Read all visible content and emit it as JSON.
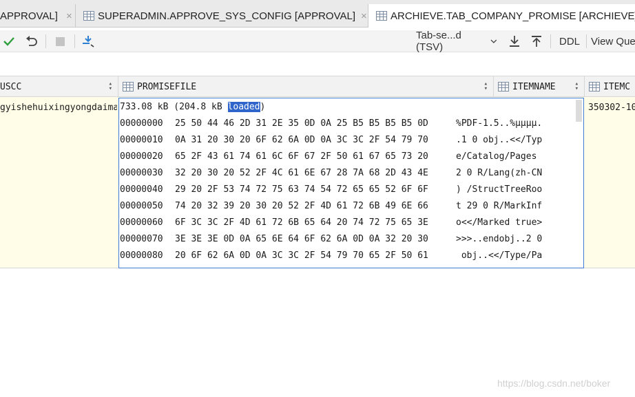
{
  "tabs": [
    {
      "label": "APPROVAL]",
      "close": "×"
    },
    {
      "label": "SUPERADMIN.APPROVE_SYS_CONFIG [APPROVAL]",
      "close": "×"
    },
    {
      "label": "ARCHIEVE.TAB_COMPANY_PROMISE [ARCHIEVE]"
    }
  ],
  "toolbar": {
    "format": "Tab-se...d (TSV)",
    "ddl": "DDL",
    "view_query": "View Que"
  },
  "columns": [
    "USCC",
    "PROMISEFILE",
    "ITEMNAME",
    "ITEMC"
  ],
  "row": {
    "uscc": "gyishehuixingyongdaima",
    "itemcode": "350302-10"
  },
  "binary": {
    "size_prefix": "733.08 kB (204.8 kB ",
    "size_selected": "loaded",
    "size_suffix": ")",
    "rows": [
      {
        "offset": "00000000",
        "hex": "25 50 44 46 2D 31 2E 35 0D 0A 25 B5 B5 B5 B5 0D",
        "text": "%PDF-1.5..%μμμμ."
      },
      {
        "offset": "00000010",
        "hex": "0A 31 20 30 20 6F 62 6A 0D 0A 3C 3C 2F 54 79 70",
        "text": ".1 0 obj..<</Typ"
      },
      {
        "offset": "00000020",
        "hex": "65 2F 43 61 74 61 6C 6F 67 2F 50 61 67 65 73 20",
        "text": "e/Catalog/Pages "
      },
      {
        "offset": "00000030",
        "hex": "32 20 30 20 52 2F 4C 61 6E 67 28 7A 68 2D 43 4E",
        "text": "2 0 R/Lang(zh-CN"
      },
      {
        "offset": "00000040",
        "hex": "29 20 2F 53 74 72 75 63 74 54 72 65 65 52 6F 6F",
        "text": ") /StructTreeRoo"
      },
      {
        "offset": "00000050",
        "hex": "74 20 32 39 20 30 20 52 2F 4D 61 72 6B 49 6E 66",
        "text": "t 29 0 R/MarkInf"
      },
      {
        "offset": "00000060",
        "hex": "6F 3C 3C 2F 4D 61 72 6B 65 64 20 74 72 75 65 3E",
        "text": "o<</Marked true>"
      },
      {
        "offset": "00000070",
        "hex": "3E 3E 3E 0D 0A 65 6E 64 6F 62 6A 0D 0A 32 20 30",
        "text": ">>>..endobj..2 0"
      },
      {
        "offset": "00000080",
        "hex": "20 6F 62 6A 0D 0A 3C 3C 2F 54 79 70 65 2F 50 61",
        "text": " obj..<</Type/Pa"
      }
    ]
  },
  "watermark": "https://blog.csdn.net/boker",
  "colors": {
    "accent": "#3d7bd6",
    "selection": "#2f65ca",
    "row_bg": "#fffde8",
    "confirm": "#2e9e3e",
    "action": "#2d7fd3"
  }
}
